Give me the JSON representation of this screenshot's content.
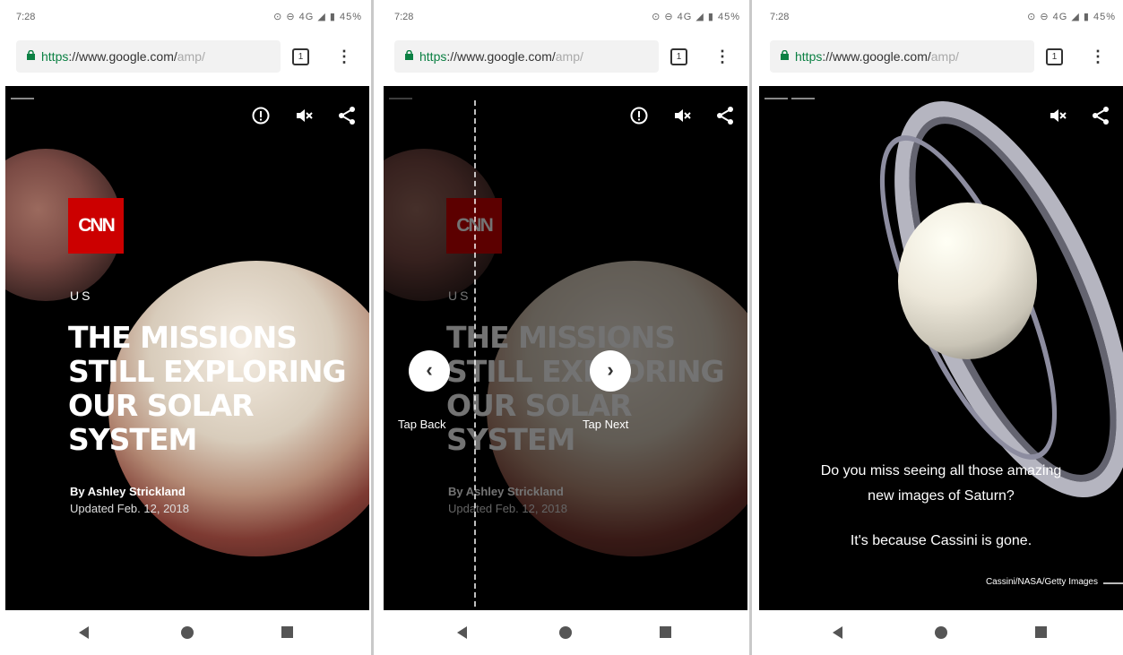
{
  "status_bar": {
    "time": "7:28",
    "icons": "⊙ ⊖ 4G ◢ ▮ 45%"
  },
  "browser": {
    "url_scheme": "https",
    "url_host": "://www.google.com/",
    "url_path": "amp/",
    "tab_count": "1",
    "menu_icon": "kebab-menu-icon"
  },
  "story": {
    "publisher": "CNN",
    "section": "US",
    "headline_lines": [
      "THE MISSIONS",
      "STILL EXPLORING",
      "OUR SOLAR",
      "SYSTEM"
    ],
    "byline": "By Ashley Strickland",
    "updated": "Updated Feb. 12, 2018"
  },
  "overlay": {
    "back_label": "Tap Back",
    "next_label": "Tap Next",
    "back_icon": "‹",
    "next_icon": "›"
  },
  "saturn": {
    "caption_line1": "Do you miss seeing all those amazing",
    "caption_line2": "new images of Saturn?",
    "caption_line3": "It's because Cassini is gone.",
    "credit": "Cassini/NASA/Getty Images"
  },
  "colors": {
    "cnn_red": "#cc0000",
    "secure_green": "#0b8043"
  },
  "icons": [
    "info-icon",
    "mute-icon",
    "share-icon",
    "back-nav-icon",
    "home-nav-icon",
    "recents-nav-icon"
  ]
}
